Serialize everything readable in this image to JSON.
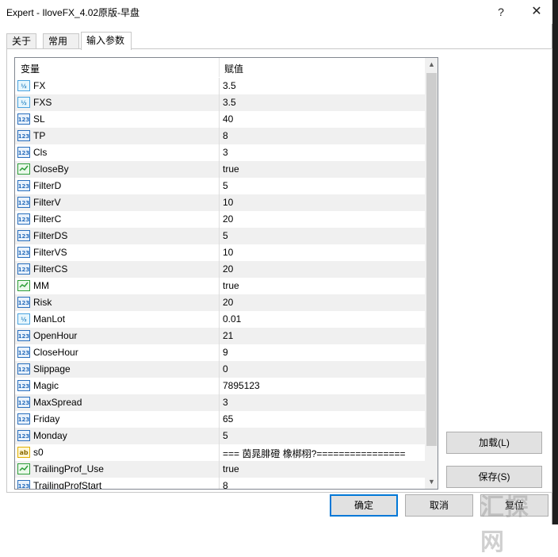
{
  "window": {
    "title": "Expert - IloveFX_4.02原版-早盘",
    "help": "?",
    "close": "✕"
  },
  "tabs": [
    {
      "label": "关于"
    },
    {
      "label": "常用"
    },
    {
      "label": "输入参数"
    }
  ],
  "grid": {
    "header": {
      "variable": "变量",
      "value": "赋值"
    },
    "rows": [
      {
        "type": "double",
        "name": "FX",
        "value": "3.5"
      },
      {
        "type": "double",
        "name": "FXS",
        "value": "3.5"
      },
      {
        "type": "int",
        "name": "SL",
        "value": "40"
      },
      {
        "type": "int",
        "name": "TP",
        "value": "8"
      },
      {
        "type": "int",
        "name": "Cls",
        "value": "3"
      },
      {
        "type": "bool",
        "name": "CloseBy",
        "value": "true"
      },
      {
        "type": "int",
        "name": "FilterD",
        "value": "5"
      },
      {
        "type": "int",
        "name": "FilterV",
        "value": "10"
      },
      {
        "type": "int",
        "name": "FilterC",
        "value": "20"
      },
      {
        "type": "int",
        "name": "FilterDS",
        "value": "5"
      },
      {
        "type": "int",
        "name": "FilterVS",
        "value": "10"
      },
      {
        "type": "int",
        "name": "FilterCS",
        "value": "20"
      },
      {
        "type": "bool",
        "name": "MM",
        "value": "true"
      },
      {
        "type": "int",
        "name": "Risk",
        "value": "20"
      },
      {
        "type": "double",
        "name": "ManLot",
        "value": "0.01"
      },
      {
        "type": "int",
        "name": "OpenHour",
        "value": "21"
      },
      {
        "type": "int",
        "name": "CloseHour",
        "value": "9"
      },
      {
        "type": "int",
        "name": "Slippage",
        "value": "0"
      },
      {
        "type": "int",
        "name": "Magic",
        "value": "7895123"
      },
      {
        "type": "int",
        "name": "MaxSpread",
        "value": "3"
      },
      {
        "type": "int",
        "name": "Friday",
        "value": "65"
      },
      {
        "type": "int",
        "name": "Monday",
        "value": "5"
      },
      {
        "type": "string",
        "name": "s0",
        "value": "=== 茵晁腓磴 橡梆栩?================"
      },
      {
        "type": "bool",
        "name": "TrailingProf_Use",
        "value": "true"
      },
      {
        "type": "int",
        "name": "TrailingProfStart",
        "value": "8"
      }
    ]
  },
  "buttons": {
    "load": "加载(L)",
    "save": "保存(S)",
    "ok": "确定",
    "cancel": "取消",
    "reset": "复位"
  },
  "watermark": "汇探网",
  "colors": {
    "accent": "#0078d7",
    "int_icon": "#2a6fbd",
    "double_icon": "#4aa3df",
    "bool_icon": "#2e9e3a",
    "string_icon": "#e0b000"
  }
}
